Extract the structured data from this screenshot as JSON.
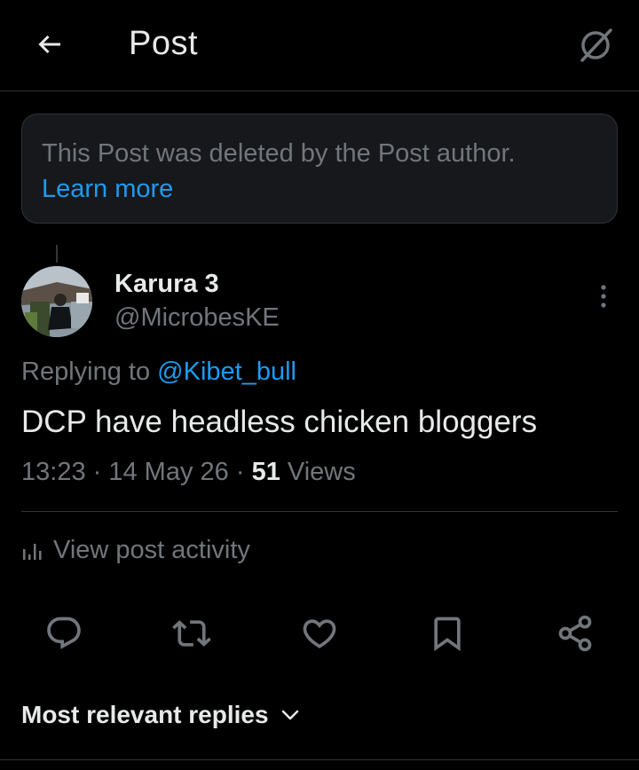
{
  "header": {
    "title": "Post",
    "back_icon": "arrow-left-icon",
    "grok_icon": "grok-icon"
  },
  "deleted_notice": {
    "message": "This Post was deleted by the Post author.",
    "link_label": "Learn more"
  },
  "post": {
    "author_name": "Karura 3",
    "author_handle": "@MicrobesKE",
    "replying_prefix": "Replying to ",
    "replying_mention": "@Kibet_bull",
    "text": "DCP have headless chicken bloggers",
    "time": "13:23",
    "date": "14 May 26",
    "separator": " · ",
    "views_count": "51",
    "views_label": " Views"
  },
  "activity": {
    "label": "View post activity",
    "icon": "bar-chart-icon"
  },
  "actions": [
    {
      "name": "reply",
      "icon": "reply-icon"
    },
    {
      "name": "repost",
      "icon": "repost-icon"
    },
    {
      "name": "like",
      "icon": "heart-icon"
    },
    {
      "name": "bookmark",
      "icon": "bookmark-icon"
    },
    {
      "name": "share",
      "icon": "share-icon"
    }
  ],
  "replies_sort": {
    "label": "Most relevant replies"
  },
  "colors": {
    "background": "#000000",
    "text_primary": "#e7e9ea",
    "text_secondary": "#71767b",
    "accent": "#1d9bf0",
    "border": "#2f3336"
  }
}
